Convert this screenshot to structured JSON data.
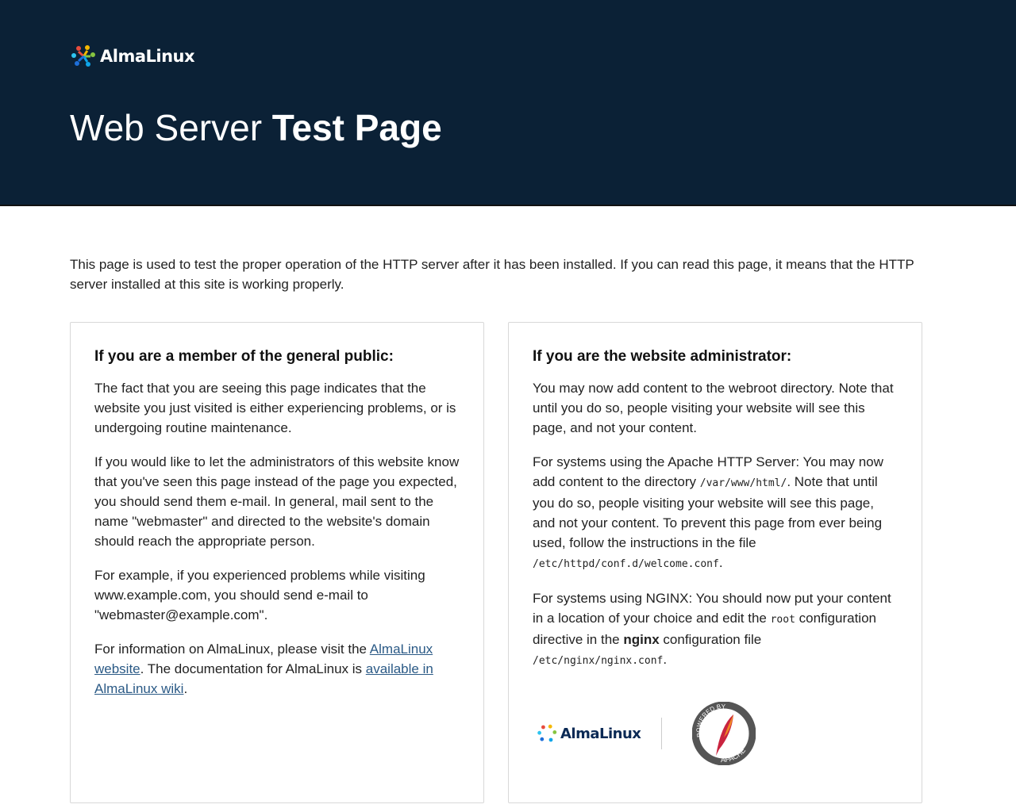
{
  "brand": {
    "name": "AlmaLinux"
  },
  "header": {
    "title_light": "Web Server ",
    "title_bold": "Test Page"
  },
  "intro": "This page is used to test the proper operation of the HTTP server after it has been installed. If you can read this page, it means that the HTTP server installed at this site is working properly.",
  "public": {
    "heading": "If you are a member of the general public:",
    "p1": "The fact that you are seeing this page indicates that the website you just visited is either experiencing problems, or is undergoing routine maintenance.",
    "p2": "If you would like to let the administrators of this website know that you've seen this page instead of the page you expected, you should send them e-mail. In general, mail sent to the name \"webmaster\" and directed to the website's domain should reach the appropriate person.",
    "p3": "For example, if you experienced problems while visiting www.example.com, you should send e-mail to \"webmaster@example.com\".",
    "p4_a": "For information on AlmaLinux, please visit the ",
    "p4_link1": "AlmaLinux website",
    "p4_b": ". The documentation for AlmaLinux is ",
    "p4_link2": "available in AlmaLinux wiki",
    "p4_c": "."
  },
  "admin": {
    "heading": "If you are the website administrator:",
    "p1": "You may now add content to the webroot directory. Note that until you do so, people visiting your website will see this page, and not your content.",
    "p2_a": "For systems using the Apache HTTP Server: You may now add content to the directory ",
    "p2_code1": "/var/www/html/",
    "p2_b": ". Note that until you do so, people visiting your website will see this page, and not your content. To prevent this page from ever being used, follow the instructions in the file ",
    "p2_code2": "/etc/httpd/conf.d/welcome.conf",
    "p2_c": ".",
    "p3_a": "For systems using NGINX: You should now put your content in a location of your choice and edit the ",
    "p3_code1": "root",
    "p3_b": " configuration directive in the ",
    "p3_bold": "nginx",
    "p3_c": " configuration file ",
    "p3_code2": "/etc/nginx/nginx.conf",
    "p3_d": ".",
    "badge_top": "POWERED BY",
    "badge_bottom": "APACHE"
  }
}
